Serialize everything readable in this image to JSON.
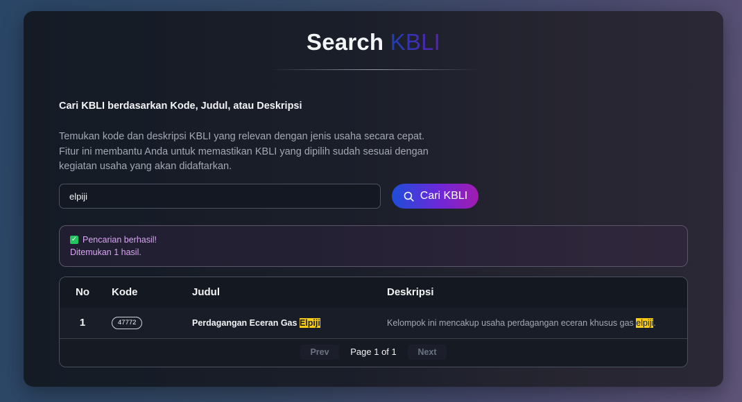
{
  "header": {
    "title_main": "Search",
    "title_accent": "KBLI"
  },
  "intro": {
    "heading": "Cari KBLI berdasarkan Kode, Judul, atau Deskripsi",
    "description_lines": [
      "Temukan kode dan deskripsi KBLI yang relevan dengan jenis usaha secara cepat.",
      "Fitur ini membantu Anda untuk memastikan KBLI yang dipilih sudah sesuai dengan",
      "kegiatan usaha yang akan didaftarkan."
    ]
  },
  "search": {
    "value": "elpiji",
    "button_label": "Cari KBLI",
    "button_icon": "search-icon"
  },
  "alert": {
    "icon": "check-box-icon",
    "title": "Pencarian berhasil!",
    "message": "Ditemukan 1 hasil."
  },
  "table": {
    "headers": {
      "no": "No",
      "kode": "Kode",
      "judul": "Judul",
      "deskripsi": "Deskripsi"
    },
    "rows": [
      {
        "no": "1",
        "kode": "47772",
        "judul_prefix": "Perdagangan Eceran Gas ",
        "judul_highlight": "Elpiji",
        "deskripsi_prefix": "Kelompok ini mencakup usaha perdagangan eceran khusus gas ",
        "deskripsi_highlight": "elpiji",
        "deskripsi_suffix": "."
      }
    ]
  },
  "pagination": {
    "prev_label": "Prev",
    "info": "Page 1 of 1",
    "next_label": "Next"
  },
  "colors": {
    "accent_gradient_start": "#1d4ed8",
    "accent_gradient_end": "#a21caf",
    "highlight": "#facc15",
    "success": "#22c55e"
  }
}
